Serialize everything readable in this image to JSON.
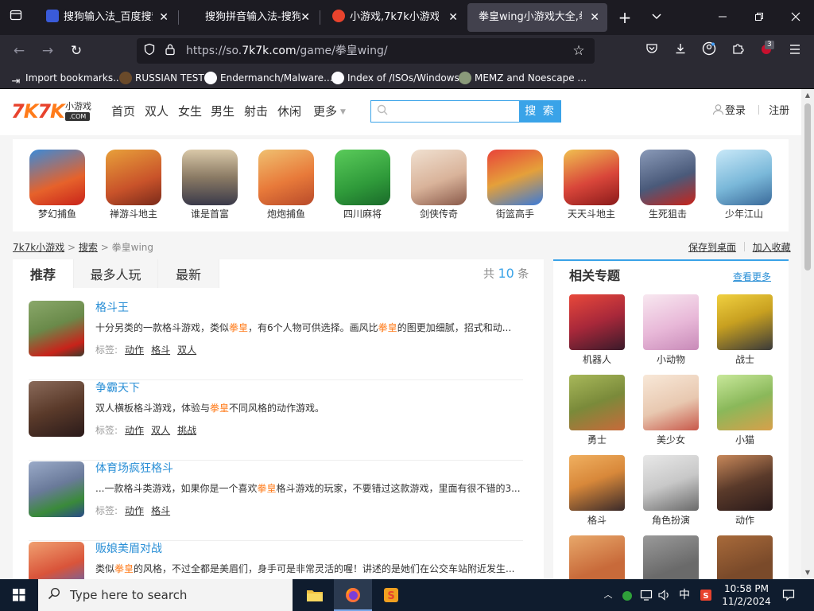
{
  "browser": {
    "tabs": [
      {
        "title": "搜狗输入法_百度搜索",
        "favicon_color": "#3a5bd9"
      },
      {
        "title": "搜狗拼音输入法-搜狗拼",
        "favicon_color": ""
      },
      {
        "title": "小游戏,7k7k小游戏,小游",
        "favicon_color": "#e8432d"
      },
      {
        "title": "拳皇wing小游戏大全,拳皇v",
        "favicon_color": ""
      }
    ],
    "url_prefix": "https://so.",
    "url_domain": "7k7k.com",
    "url_path": "/game/拳皇wing/",
    "extension_badge": "3",
    "bookmarks": [
      {
        "label": "Import bookmarks...",
        "icon": "import-icon"
      },
      {
        "label": "RUSSIAN TEST",
        "icon": "sphere-icon"
      },
      {
        "label": "Endermanch/Malware...",
        "icon": "github-icon"
      },
      {
        "label": "Index of /ISOs/Windows",
        "icon": "github-icon"
      },
      {
        "label": "MEMZ and Noescape ...",
        "icon": "globe-icon"
      }
    ]
  },
  "site": {
    "logo_text": "7K7K",
    "logo_small": "小游戏",
    "logo_com": ".COM",
    "nav": [
      "首页",
      "双人",
      "女生",
      "男生",
      "射击",
      "休闲",
      "更多"
    ],
    "search_button": "搜 索",
    "search_value": "",
    "login": "登录",
    "register": "注册"
  },
  "top_games": [
    {
      "name": "梦幻捕鱼",
      "color": "#e6622b"
    },
    {
      "name": "禅游斗地主",
      "color": "#c9532a"
    },
    {
      "name": "谁是首富",
      "color": "#8a7a64"
    },
    {
      "name": "炮炮捕鱼",
      "color": "#e87a3a"
    },
    {
      "name": "四川麻将",
      "color": "#2f9a3a"
    },
    {
      "name": "剑侠传奇",
      "color": "#d9b39a"
    },
    {
      "name": "街篮高手",
      "color": "#e5a03a"
    },
    {
      "name": "天天斗地主",
      "color": "#d9463a"
    },
    {
      "name": "生死狙击",
      "color": "#4a5a7a"
    },
    {
      "name": "少年江山",
      "color": "#7ab8d9"
    }
  ],
  "breadcrumb": {
    "home": "7k7k小游戏",
    "search": "搜索",
    "current": "拳皇wing",
    "sep": ">",
    "save_desktop": "保存到桌面",
    "add_favorite": "加入收藏"
  },
  "result_tabs": [
    "推荐",
    "最多人玩",
    "最新"
  ],
  "count": {
    "prefix": "共",
    "num": "10",
    "suffix": "条"
  },
  "tags_label": "标签:",
  "results": [
    {
      "title": "格斗王",
      "desc_pre": "十分另类的一款格斗游戏，类似",
      "desc_hl": "拳皇",
      "desc_post": "，有6个人物可供选择。画风比",
      "desc_hl2": "拳皇",
      "desc_post2": "的图更加细腻，招式和动...",
      "tags": [
        "动作",
        "格斗",
        "双人"
      ],
      "color": "#6a8a4a"
    },
    {
      "title": "争霸天下",
      "desc_pre": "双人横板格斗游戏，体验与",
      "desc_hl": "拳皇",
      "desc_post": "不同风格的动作游戏。",
      "desc_hl2": "",
      "desc_post2": "",
      "tags": [
        "动作",
        "双人",
        "挑战"
      ],
      "color": "#5a3a2a"
    },
    {
      "title": "体育场疯狂格斗",
      "desc_pre": "...一款格斗类游戏，如果你是一个喜欢",
      "desc_hl": "拳皇",
      "desc_post": "格斗游戏的玩家，不要错过这款游戏，里面有很不错的3...",
      "desc_hl2": "",
      "desc_post2": "",
      "tags": [
        "动作",
        "格斗"
      ],
      "color": "#6a7a9a"
    },
    {
      "title": "贩娘美眉对战",
      "desc_pre": "类似",
      "desc_hl": "拳皇",
      "desc_post": "的风格，不过全都是美眉们，身手可是非常灵活的喔！讲述的是她们在公交车站附近发生...",
      "desc_hl2": "",
      "desc_post2": "",
      "tags": [],
      "color": "#d9543a"
    }
  ],
  "topics": {
    "title": "相关专题",
    "more": "查看更多",
    "items": [
      {
        "name": "机器人",
        "color": "#a8283a"
      },
      {
        "name": "小动物",
        "color": "#e8b8d8"
      },
      {
        "name": "战士",
        "color": "#c8a020"
      },
      {
        "name": "勇士",
        "color": "#7a8a3a"
      },
      {
        "name": "美少女",
        "color": "#e8c8b0"
      },
      {
        "name": "小猫",
        "color": "#8ab85a"
      },
      {
        "name": "格斗",
        "color": "#d8883a"
      },
      {
        "name": "角色扮演",
        "color": "#c8c8c8"
      },
      {
        "name": "动作",
        "color": "#5a3a2a"
      },
      {
        "name": "",
        "color": "#c86a3a"
      },
      {
        "name": "",
        "color": "#6a6a6a"
      },
      {
        "name": "",
        "color": "#7a4a2a"
      }
    ]
  },
  "taskbar": {
    "search_placeholder": "Type here to search",
    "ime": "中",
    "time": "10:58 PM",
    "date": "11/2/2024"
  }
}
